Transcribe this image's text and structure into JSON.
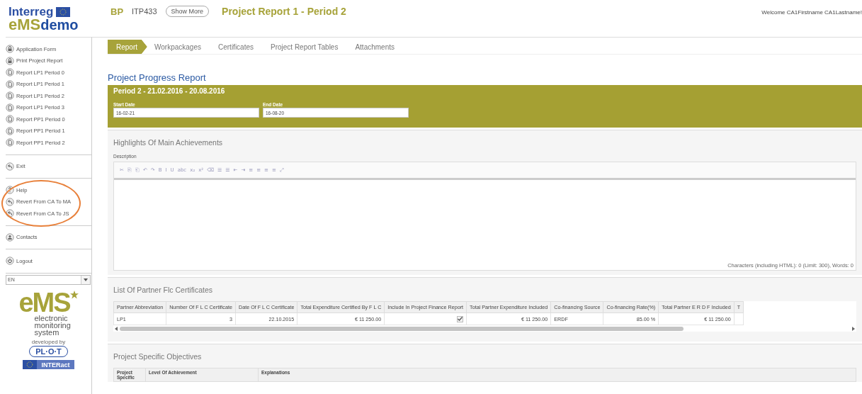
{
  "header": {
    "logo": {
      "top": "Interreg",
      "brand": "eMS",
      "suffix": "demo"
    },
    "code": "BP",
    "project_id": "ITP433",
    "show_more_button": "Show More",
    "title": "Project Report 1 - Period 2",
    "welcome": "Welcome CA1Firstname CA1Lastname!"
  },
  "sidebar": {
    "groups": [
      {
        "circled": false,
        "items": [
          {
            "label": "Application Form",
            "kind": "lock"
          },
          {
            "label": "Print Project Report",
            "kind": "lock"
          },
          {
            "label": "Report LP1 Period 0",
            "kind": "doc"
          },
          {
            "label": "Report LP1 Period 1",
            "kind": "doc"
          },
          {
            "label": "Report LP1 Period 2",
            "kind": "doc"
          },
          {
            "label": "Report LP1 Period 3",
            "kind": "doc"
          },
          {
            "label": "Report PP1 Period 0",
            "kind": "doc"
          },
          {
            "label": "Report PP1 Period 1",
            "kind": "doc"
          },
          {
            "label": "Report PP1 Period 2",
            "kind": "doc"
          }
        ]
      },
      {
        "circled": false,
        "items": [
          {
            "label": "Exit",
            "kind": "back"
          }
        ]
      },
      {
        "circled": true,
        "items": [
          {
            "label": "Help",
            "kind": "help"
          },
          {
            "label": "Revert From CA To MA",
            "kind": "back"
          },
          {
            "label": "Revert From CA To JS",
            "kind": "back"
          }
        ]
      },
      {
        "circled": false,
        "items": [
          {
            "label": "Contacts",
            "kind": "person"
          }
        ]
      },
      {
        "circled": false,
        "items": [
          {
            "label": "Logout",
            "kind": "power"
          }
        ]
      }
    ],
    "language": "EN",
    "footer_logo": {
      "brand": "eMS",
      "tagline": "electronic monitoring system",
      "developer_label": "developed by",
      "developer": "PL·O·T",
      "partner": "INTERact"
    }
  },
  "tabs": [
    {
      "label": "Report",
      "selected": true
    },
    {
      "label": "Workpackages",
      "selected": false
    },
    {
      "label": "Certificates",
      "selected": false
    },
    {
      "label": "Project Report Tables",
      "selected": false
    },
    {
      "label": "Attachments",
      "selected": false
    }
  ],
  "page_title": "Project Progress Report",
  "period": {
    "title": "Period 2 - 21.02.2016 - 20.08.2016",
    "fields": [
      {
        "label": "Start Date",
        "value": "16-02-21"
      },
      {
        "label": "End Date",
        "value": "16-08-20"
      }
    ]
  },
  "highlights": {
    "title": "Highlights Of Main Achievements",
    "field_label": "Description",
    "toolbar": [
      "✂",
      "⎘",
      "⎗",
      "↶",
      "↷",
      "B",
      "I",
      "U",
      "abc",
      "x₂",
      "x²",
      "⌫",
      "☰",
      "☰",
      "⇤",
      "⇥",
      "≡",
      "≡",
      "≡",
      "≡",
      "⤢"
    ],
    "counter": "Characters (including HTML): 0 (Limit: 300), Words: 0"
  },
  "certificates": {
    "title": "List Of Partner Flc Certificates",
    "table": {
      "columns": [
        "Partner Abbreviation",
        "Number Of F L C Certificate",
        "Date Of F L C Certificate",
        "Total Expenditure Certified By F L C",
        "Include In Project Finance Report",
        "Total Partner Expenditure Included",
        "Co-financing Source",
        "Co-financing Rate(%)",
        "Total Partner E R D F Included",
        "T"
      ],
      "rows": [
        {
          "cells": [
            {
              "kind": "text",
              "text": "LP1"
            },
            {
              "kind": "number",
              "text": "3"
            },
            {
              "kind": "number",
              "text": "22.10.2015"
            },
            {
              "kind": "number",
              "text": "€ 11 250.00"
            },
            {
              "kind": "checkbox",
              "checked": true
            },
            {
              "kind": "number",
              "text": "€ 11 250.00"
            },
            {
              "kind": "text",
              "text": "ERDF"
            },
            {
              "kind": "number",
              "text": "85.00 %"
            },
            {
              "kind": "number",
              "text": "€ 11 250.00"
            },
            {
              "kind": "blank"
            }
          ]
        }
      ]
    }
  },
  "objectives": {
    "title": "Project Specific Objectives",
    "table": {
      "columns": [
        "Project Specific",
        "Level Of Achievement",
        "Explanations"
      ]
    }
  }
}
